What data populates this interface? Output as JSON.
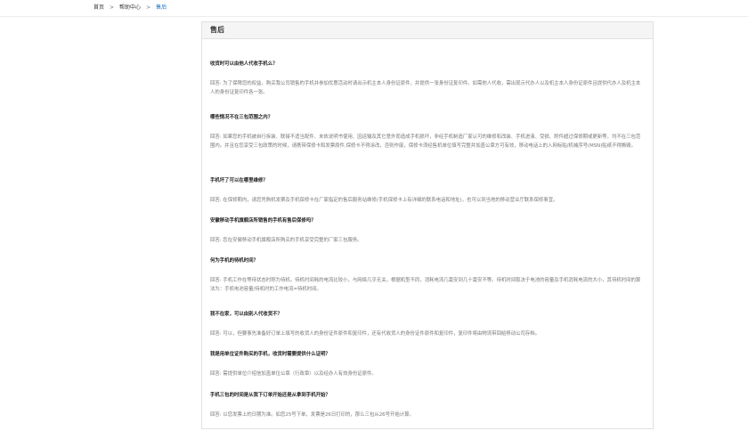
{
  "breadcrumb": {
    "home": "首页",
    "help": "帮助中心",
    "current": "售后",
    "separator": ">"
  },
  "panel": {
    "title": "售后"
  },
  "faq": [
    {
      "q": "收货时可以由他人代收手机么？",
      "a": "回答: 为了保障您的权益，购买我公司销售的手机并参加优惠活动时请出示机主本人身份证原件，并提供一张身份证复印件。如需他人代收，需出现示代办人以及机主本人身份证原件且提供代办人及机主本人的身份证复印件各一张。"
    },
    {
      "q": "哪些情况不在三包范围之内？",
      "a": "回答: 如果您的手机被自行拆装、联接不适当配件、未依说明书使用、因运输及其它意外而造成手机损坏，非经手机制造厂家认可的维修和改装、手机进液、受损、附件超过保修期或更新等，均不在三包范围内。并且在您享受三包政策的时候，请携带保修卡和发票原件,保修卡不得涂改，否则作废，保修卡须经售机单位填写完整并加盖公章方可有效，移动电话上的入网标贴/机械序号(MSN)贴纸不得撕毁。"
    },
    {
      "q": "手机坏了可以在哪里维修？",
      "a": "回答: 在保修期内，请您凭购机发票及手机保修卡在厂家指定的售后服务站维修(手机保修卡上有详细的联系电话和地址)，也可以到当地的移动营业厅联系保修事宜。"
    },
    {
      "q": "安徽移动手机旗舰店所销售的手机有售后保修吗？",
      "a": "回答: 您在安徽移动手机旗舰店所购买的手机享受完整的厂家三包服务。"
    },
    {
      "q": "何为手机的待机时间？",
      "a": "回答: 手机工作在等待状态时称为待机。待机时间耗的电流比较小，与网络几乎无关，根据机型不同，消耗电流几毫安到几十毫安不等。待机时间取决于电池的容量及手机消耗电流的大小，其待机时间的算法为：手机电池容量/待机时的工作电流=待机时间。"
    },
    {
      "q": "我不在家，可以由别人代收货不？",
      "a": "回答: 可以，但要事先准备好订单上填写的收货人的身份证件原件和复印件，还有代收货人的身份证件原件和复印件，复印件将由物流带回给移动公司存档。"
    },
    {
      "q": "我是用单位证件购买的手机，收货时需要提供什么证明？",
      "a": "回答: 需提供单位介绍信加盖单位公章（行政章）以及经办人有效身份证原件。"
    },
    {
      "q": "手机三包的时间是从我下订单开始还是从拿到手机开始？",
      "a": "回答: 以您发票上的日期为准。如您25号下单，发票是26日打印的，那么三包从26号开始计算。"
    }
  ]
}
